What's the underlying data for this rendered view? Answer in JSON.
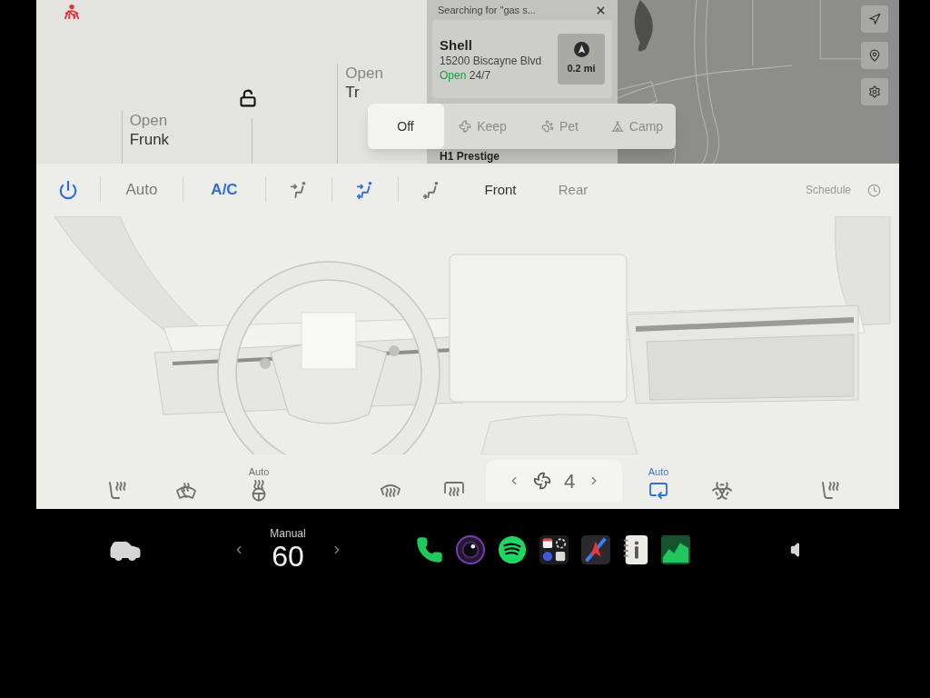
{
  "car_controls": {
    "locked": false,
    "frunk": {
      "lines": [
        "Open",
        "Frunk"
      ]
    },
    "trunk": {
      "lines": [
        "Open",
        "Tr"
      ]
    }
  },
  "map": {
    "search_title": "Searching for \"gas s...",
    "results": [
      {
        "name": "Shell",
        "address": "15200 Biscayne Blvd",
        "status": "Open",
        "hours": "24/7",
        "distance": "0.2 mi"
      },
      {
        "name": "H1 Prestige"
      }
    ]
  },
  "camp_mode": {
    "options": [
      {
        "kind": "off",
        "label": "Off",
        "selected": true
      },
      {
        "kind": "keep",
        "label": "Keep",
        "selected": false
      },
      {
        "kind": "pet",
        "label": "Pet",
        "selected": false
      },
      {
        "kind": "camp",
        "label": "Camp",
        "selected": false
      }
    ]
  },
  "climate": {
    "power": {
      "on": true
    },
    "auto": {
      "label": "Auto",
      "on": false
    },
    "ac": {
      "label": "A/C",
      "on": true
    },
    "airflow": [
      {
        "kind": "face",
        "selected": false
      },
      {
        "kind": "face_feet",
        "selected": true
      },
      {
        "kind": "feet",
        "selected": false
      }
    ],
    "zones": [
      {
        "label": "Front",
        "selected": true
      },
      {
        "label": "Rear",
        "selected": false
      }
    ],
    "schedule": "Schedule",
    "bottom_left": [
      {
        "kind": "seat_heater"
      },
      {
        "kind": "wiper_defrost"
      },
      {
        "kind": "steering_heater",
        "label": "Auto"
      },
      {
        "kind": "front_defrost"
      },
      {
        "kind": "rear_defrost"
      }
    ],
    "fan": {
      "speed": "4"
    },
    "bottom_right": [
      {
        "kind": "recirculate",
        "label": "Auto",
        "on": true
      },
      {
        "kind": "bioweapon"
      },
      {
        "kind": "seat_heater"
      }
    ]
  },
  "taskbar": {
    "temperature": {
      "mode": "Manual",
      "value": "60"
    },
    "apps": [
      {
        "kind": "phone"
      },
      {
        "kind": "camera"
      },
      {
        "kind": "music"
      },
      {
        "kind": "launcher"
      },
      {
        "kind": "navigation"
      },
      {
        "kind": "manual"
      },
      {
        "kind": "stocks"
      }
    ]
  }
}
